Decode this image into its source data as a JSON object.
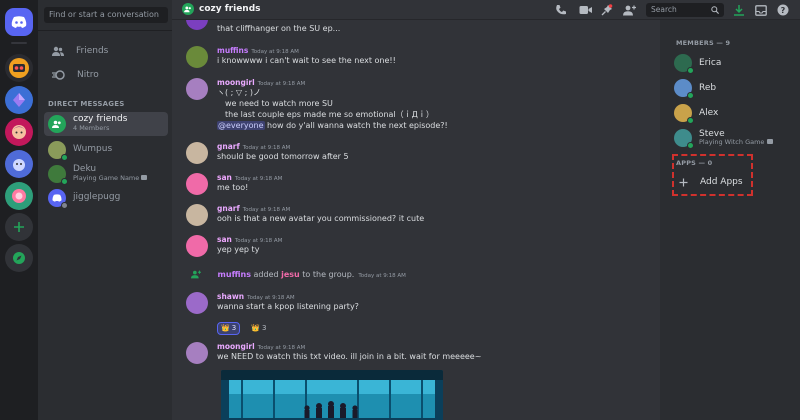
{
  "sidebar": {
    "search_placeholder": "Find or start a conversation",
    "nav": [
      {
        "label": "Friends",
        "icon": "friends-icon"
      },
      {
        "label": "Nitro",
        "icon": "nitro-icon"
      }
    ],
    "dm_header": "DIRECT MESSAGES",
    "dms": [
      {
        "name": "cozy friends",
        "sub": "4 Members"
      },
      {
        "name": "Wumpus",
        "sub": ""
      },
      {
        "name": "Deku",
        "sub": "Playing Game Name"
      },
      {
        "name": "jigglepugg",
        "sub": ""
      }
    ]
  },
  "header": {
    "channel": "cozy friends",
    "search_placeholder": "Search"
  },
  "messages": {
    "m0_text": "that cliffhanger on the SU ep...",
    "m1": {
      "author": "muffins",
      "ts": "Today at 9:18 AM",
      "text": "i knowwww i can't wait to see the next one!!"
    },
    "m2": {
      "author": "moongirl",
      "ts": "Today at 9:18 AM",
      "line1": "ヽ( ; ▽ ; )ノ",
      "line2": "we need to watch more SU",
      "line3": "the last couple eps made me so emotional（ｉДｉ）",
      "mention": "@everyone",
      "line4": " how do y'all wanna watch the next episode?!"
    },
    "m3": {
      "author": "gnarf",
      "ts": "Today at 9:18 AM",
      "text": "should be good tomorrow after 5"
    },
    "m4": {
      "author": "san",
      "ts": "Today at 9:18 AM",
      "text": "me too!"
    },
    "m5": {
      "author": "gnarf",
      "ts": "Today at 9:18 AM",
      "text": "ooh is that a new avatar you commissioned? it cute"
    },
    "m6": {
      "author": "san",
      "ts": "Today at 9:18 AM",
      "text": "yep yep ty"
    },
    "sys": {
      "actor": "muffins",
      "mid": " added ",
      "target": "jesu",
      "tail": " to the group.",
      "ts": "Today at 9:18 AM"
    },
    "m7": {
      "author": "shawn",
      "ts": "Today at 9:18 AM",
      "text": "wanna start a kpop listening party?",
      "react1": "3",
      "react2": "3"
    },
    "m8": {
      "author": "moongirl",
      "ts": "Today at 9:18 AM",
      "text": "we NEED to watch this txt video. ill join in a bit. wait for meeeee~"
    }
  },
  "members": {
    "header": "MEMBERS — 9",
    "list": [
      {
        "name": "Erica",
        "sub": ""
      },
      {
        "name": "Reb",
        "sub": ""
      },
      {
        "name": "Alex",
        "sub": ""
      },
      {
        "name": "Steve",
        "sub": "Playing Witch Game"
      }
    ],
    "apps_header": "APPS — 0",
    "add_apps": "Add Apps"
  },
  "colors": {
    "accent": "#5865f2",
    "online": "#23a55a",
    "highlight_box": "#d0312d"
  }
}
